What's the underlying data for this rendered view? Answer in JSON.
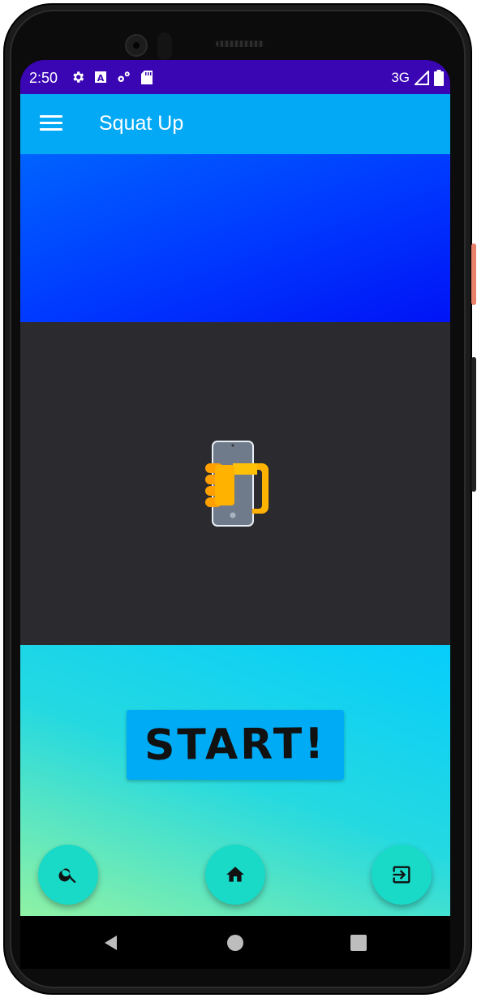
{
  "status_bar": {
    "time": "2:50",
    "network": "3G",
    "icons": [
      "settings-icon",
      "a-notification-icon",
      "sync-icon",
      "sd-card-icon",
      "signal-icon",
      "battery-icon"
    ]
  },
  "app_bar": {
    "title": "Squat Up",
    "menu_icon": "hamburger-menu-icon",
    "background": "#03a9f4"
  },
  "video_area": {
    "placeholder_icon": "phone-rotate-hand-icon"
  },
  "start_button": {
    "label": "START!"
  },
  "fab_buttons": [
    {
      "id": "search",
      "icon": "search-icon"
    },
    {
      "id": "home",
      "icon": "home-icon"
    },
    {
      "id": "exit",
      "icon": "exit-icon"
    }
  ],
  "nav_bar": {
    "buttons": [
      "back-icon",
      "home-circle-icon",
      "recents-icon"
    ]
  },
  "colors": {
    "status_bar": "#3a06b4",
    "banner": "#0037ff",
    "video_bg": "#2a2a2f",
    "fab": "#19d9c7",
    "start_button": "#00abf5"
  }
}
